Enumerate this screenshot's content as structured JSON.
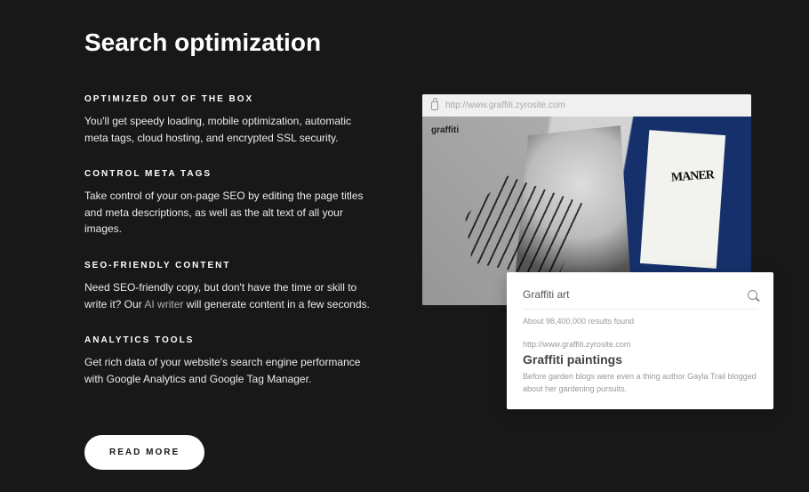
{
  "title": "Search optimization",
  "sections": [
    {
      "heading": "OPTIMIZED OUT OF THE BOX",
      "body": "You'll get speedy loading, mobile optimization, automatic meta tags, cloud hosting, and encrypted SSL security."
    },
    {
      "heading": "CONTROL META TAGS",
      "body": "Take control of your on-page SEO by editing the page titles and meta descriptions, as well as the alt text of all your images."
    },
    {
      "heading": "SEO-FRIENDLY CONTENT",
      "body_pre": "Need SEO-friendly copy, but don't have the time or skill to write it? Our ",
      "link": "AI writer",
      "body_post": " will generate content in a few seconds."
    },
    {
      "heading": "ANALYTICS TOOLS",
      "body": "Get rich data of your website's search engine performance with Google Analytics and Google Tag Manager."
    }
  ],
  "cta": "READ MORE",
  "browser": {
    "url": "http://www.graffiti.zyrosite.com",
    "brand": "graffiti",
    "tag": "MANER"
  },
  "card": {
    "search_value": "Graffiti art",
    "results_text": "About 98,400,000 results found",
    "result_url": "http://www.graffiti.zyrosite.com",
    "result_title": "Graffiti paintings",
    "result_desc": "Before garden blogs were even a thing author Gayla Trail blogged about her gardening pursuits."
  }
}
